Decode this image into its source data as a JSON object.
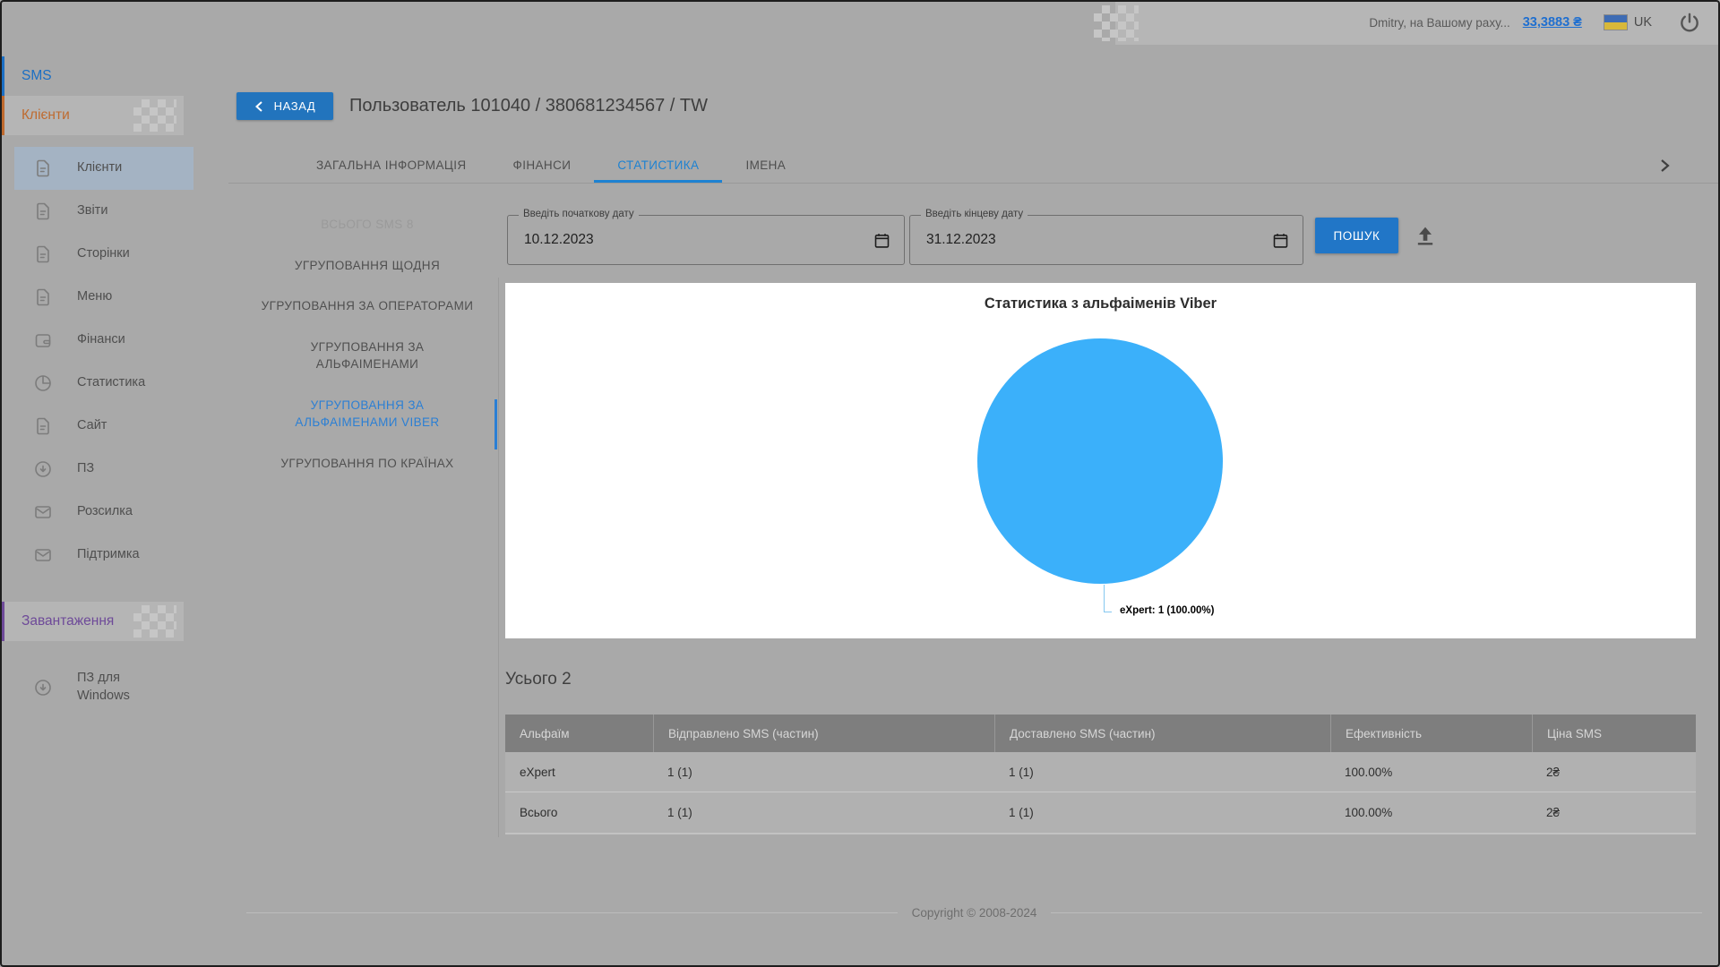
{
  "header": {
    "user_greeting": "Dmitry, на Вашому раху...",
    "balance": "33,3883 ₴",
    "language": "UK",
    "icons": {
      "flag": "ukraine-flag-icon",
      "power": "power-icon"
    }
  },
  "sidebar": {
    "section_sms": "SMS",
    "section_clients": "Клієнти",
    "section_downloads": "Завантаження",
    "items": [
      {
        "label": "Клієнти",
        "icon": "document-icon",
        "active": true
      },
      {
        "label": "Звіти",
        "icon": "document-icon"
      },
      {
        "label": "Сторінки",
        "icon": "document-icon"
      },
      {
        "label": "Меню",
        "icon": "document-icon"
      },
      {
        "label": "Фінанси",
        "icon": "wallet-icon"
      },
      {
        "label": "Статистика",
        "icon": "pie-chart-icon"
      },
      {
        "label": "Сайт",
        "icon": "document-icon"
      },
      {
        "label": "ПЗ",
        "icon": "download-icon"
      },
      {
        "label": "Розсилка",
        "icon": "mail-icon"
      },
      {
        "label": "Підтримка",
        "icon": "mail-icon"
      }
    ],
    "downloads_item": {
      "label": "ПЗ для Windows",
      "icon": "download-icon"
    }
  },
  "page": {
    "back_button": "НАЗАД",
    "title": "Пользователь 101040 / 380681234567 / TW",
    "tabs": [
      {
        "label": "ЗАГАЛЬНА ІНФОРМАЦІЯ",
        "active": false
      },
      {
        "label": "ФІНАНСИ",
        "active": false
      },
      {
        "label": "СТАТИСТИКА",
        "active": true
      },
      {
        "label": "ІМЕНА",
        "active": false
      }
    ]
  },
  "subnav": [
    {
      "label": "ВСЬОГО SMS 8",
      "static": true
    },
    {
      "label": "УГРУПОВАННЯ ЩОДНЯ"
    },
    {
      "label": "УГРУПОВАННЯ ЗА ОПЕРАТОРАМИ"
    },
    {
      "label": "УГРУПОВАННЯ ЗА АЛЬФАІМЕНАМИ"
    },
    {
      "label": "УГРУПОВАННЯ ЗА АЛЬФАІМЕНАМИ VIBER",
      "active": true
    },
    {
      "label": "УГРУПОВАННЯ ПО КРАЇНАХ"
    }
  ],
  "filters": {
    "start_label": "Введіть початкову дату",
    "start_value": "10.12.2023",
    "end_label": "Введіть кінцеву дату",
    "end_value": "31.12.2023",
    "search_button": "ПОШУК",
    "export_icon": "upload-export-icon"
  },
  "chart_data": {
    "type": "pie",
    "title": "Статистика з альфаіменів Viber",
    "labels": [
      "eXpert"
    ],
    "values": [
      1
    ],
    "percentages": [
      100.0
    ],
    "colors": [
      "#3bb0fa"
    ],
    "annotation": "eXpert: 1 (100.00%)",
    "legend_position": "none",
    "background": "#ffffff"
  },
  "totals": {
    "heading": "Усього 2"
  },
  "table": {
    "headers": [
      "Альфаїм",
      "Відправлено SMS (частин)",
      "Доставлено SMS (частин)",
      "Ефективність",
      "Ціна SMS"
    ],
    "rows": [
      [
        "eXpert",
        "1 (1)",
        "1 (1)",
        "100.00%",
        "2₴"
      ],
      [
        "Всього",
        "1 (1)",
        "1 (1)",
        "100.00%",
        "2₴"
      ]
    ]
  },
  "footer": {
    "copyright": "Copyright © 2008-2024"
  },
  "colors": {
    "accent_blue": "#2176c7",
    "tab_active_blue": "#1d82d2",
    "sms_blue": "#1b6fc4",
    "clients_orange": "#bf6a2e",
    "downloads_purple": "#6e4a99",
    "pie_blue": "#3bb0fa",
    "page_background": "#a9a9a9"
  }
}
